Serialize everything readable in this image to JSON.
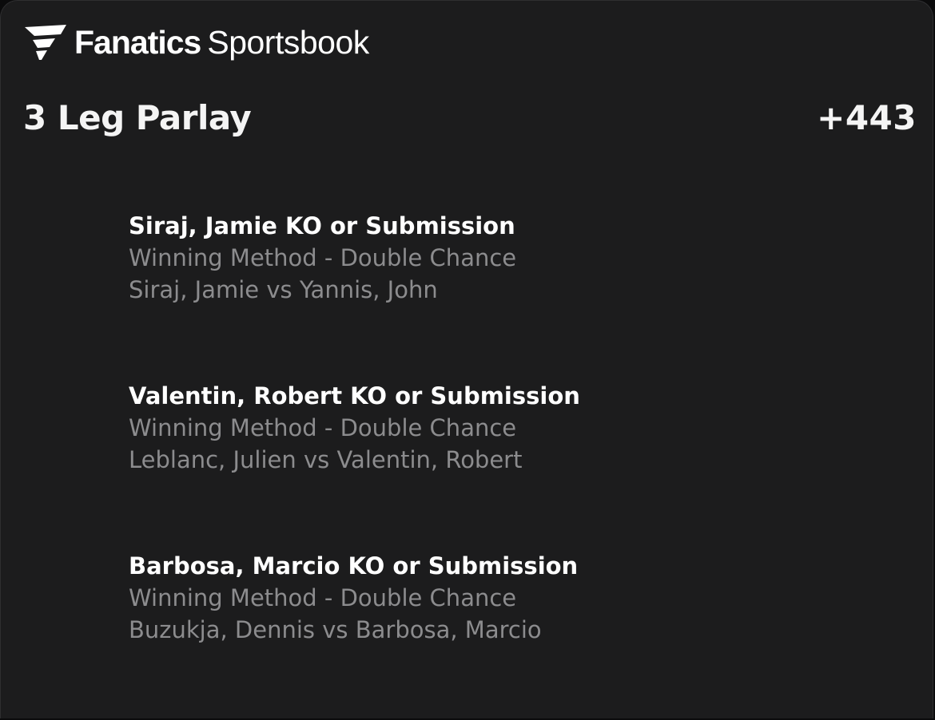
{
  "brand": {
    "logo_icon": "fanatics-flag-icon",
    "name_bold": "Fanatics",
    "name_regular": "Sportsbook"
  },
  "bet": {
    "title": "3 Leg Parlay",
    "odds": "+443",
    "legs": [
      {
        "selection": "Siraj, Jamie KO or Submission",
        "market": "Winning Method - Double Chance",
        "matchup": "Siraj, Jamie vs Yannis, John"
      },
      {
        "selection": "Valentin, Robert KO or Submission",
        "market": "Winning Method - Double Chance",
        "matchup": "Leblanc, Julien vs Valentin, Robert"
      },
      {
        "selection": "Barbosa, Marcio KO or Submission",
        "market": "Winning Method - Double Chance",
        "matchup": "Buzukja, Dennis vs Barbosa, Marcio"
      }
    ]
  },
  "colors": {
    "card_background": "#1c1c1d",
    "primary_text": "#ffffff",
    "secondary_text": "#8c8c8e"
  }
}
